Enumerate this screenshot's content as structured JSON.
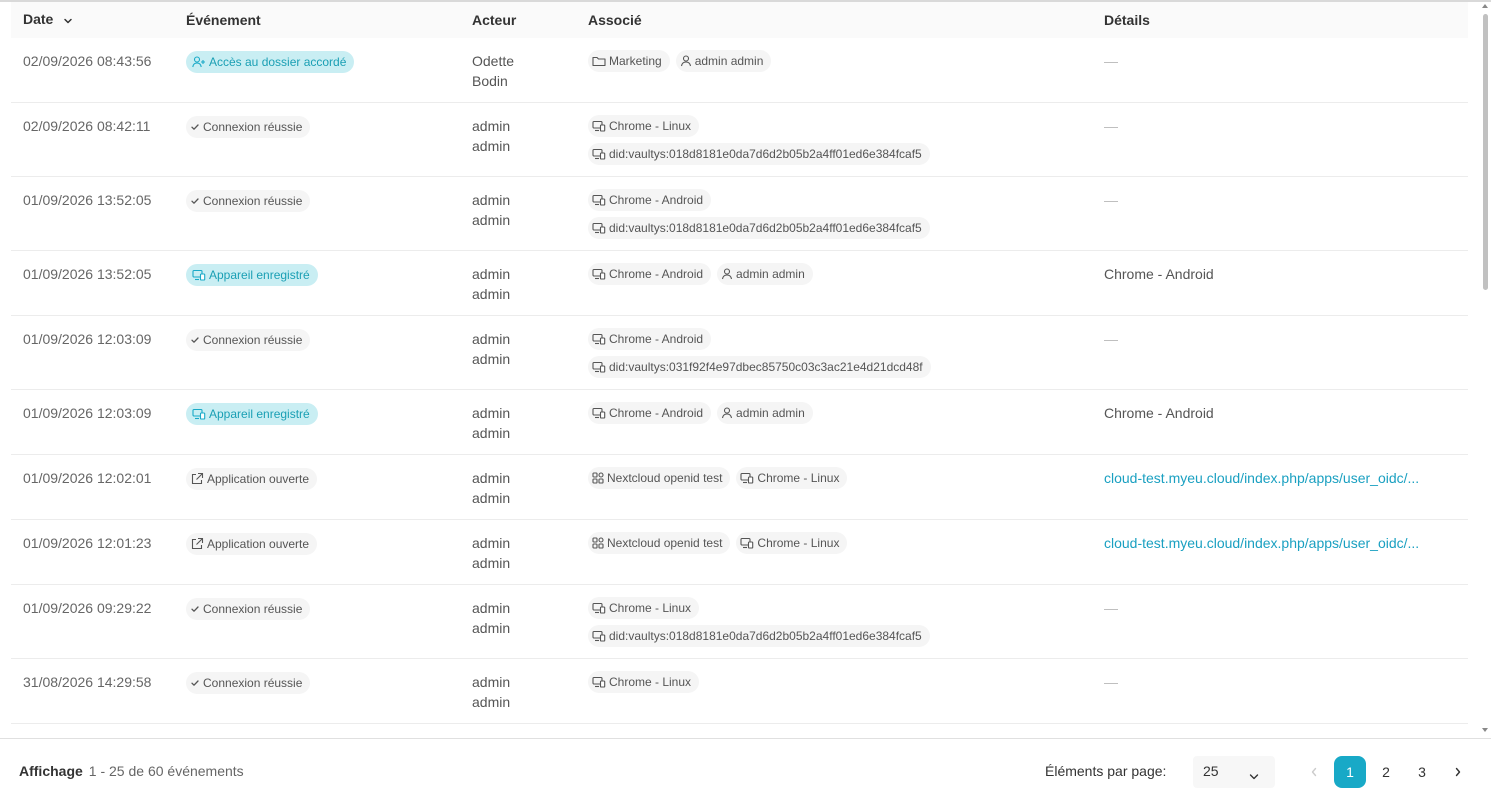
{
  "columns": {
    "date": "Date",
    "event": "Événement",
    "actor": "Acteur",
    "associated": "Associé",
    "details": "Détails"
  },
  "rows": [
    {
      "date": "02/09/2026 08:43:56",
      "event": "Accès au dossier accordé",
      "event_style": "accent",
      "event_icon": "user-plus-icon",
      "actor_line1": "Odette",
      "actor_line2": "Bodin",
      "assoc": [
        {
          "icon": "folder-icon",
          "label": "Marketing"
        },
        {
          "icon": "user-icon",
          "label": "admin admin"
        }
      ],
      "assoc_stack": false,
      "details": "—",
      "details_type": "dash"
    },
    {
      "date": "02/09/2026 08:42:11",
      "event": "Connexion réussie",
      "event_style": "plain",
      "event_icon": "check-icon",
      "actor_line1": "admin",
      "actor_line2": "admin",
      "assoc": [
        {
          "icon": "devices-icon",
          "label": "Chrome - Linux"
        },
        {
          "icon": "devices-icon",
          "label": "did:vaultys:018d8181e0da7d6d2b05b2a4ff01ed6e384fcaf5"
        }
      ],
      "assoc_stack": true,
      "details": "—",
      "details_type": "dash"
    },
    {
      "date": "01/09/2026 13:52:05",
      "event": "Connexion réussie",
      "event_style": "plain",
      "event_icon": "check-icon",
      "actor_line1": "admin",
      "actor_line2": "admin",
      "assoc": [
        {
          "icon": "devices-icon",
          "label": "Chrome - Android"
        },
        {
          "icon": "devices-icon",
          "label": "did:vaultys:018d8181e0da7d6d2b05b2a4ff01ed6e384fcaf5"
        }
      ],
      "assoc_stack": true,
      "details": "—",
      "details_type": "dash"
    },
    {
      "date": "01/09/2026 13:52:05",
      "event": "Appareil enregistré",
      "event_style": "accent",
      "event_icon": "devices-icon",
      "actor_line1": "admin",
      "actor_line2": "admin",
      "assoc": [
        {
          "icon": "devices-icon",
          "label": "Chrome - Android"
        },
        {
          "icon": "user-icon",
          "label": "admin admin"
        }
      ],
      "assoc_stack": false,
      "details": "Chrome - Android",
      "details_type": "text"
    },
    {
      "date": "01/09/2026 12:03:09",
      "event": "Connexion réussie",
      "event_style": "plain",
      "event_icon": "check-icon",
      "actor_line1": "admin",
      "actor_line2": "admin",
      "assoc": [
        {
          "icon": "devices-icon",
          "label": "Chrome - Android"
        },
        {
          "icon": "devices-icon",
          "label": "did:vaultys:031f92f4e97dbec85750c03c3ac21e4d21dcd48f"
        }
      ],
      "assoc_stack": true,
      "details": "—",
      "details_type": "dash"
    },
    {
      "date": "01/09/2026 12:03:09",
      "event": "Appareil enregistré",
      "event_style": "accent",
      "event_icon": "devices-icon",
      "actor_line1": "admin",
      "actor_line2": "admin",
      "assoc": [
        {
          "icon": "devices-icon",
          "label": "Chrome - Android"
        },
        {
          "icon": "user-icon",
          "label": "admin admin"
        }
      ],
      "assoc_stack": false,
      "details": "Chrome - Android",
      "details_type": "text"
    },
    {
      "date": "01/09/2026 12:02:01",
      "event": "Application ouverte",
      "event_style": "plain",
      "event_icon": "external-link-icon",
      "actor_line1": "admin",
      "actor_line2": "admin",
      "assoc": [
        {
          "icon": "apps-icon",
          "label": "Nextcloud openid test"
        },
        {
          "icon": "devices-icon",
          "label": "Chrome - Linux"
        }
      ],
      "assoc_stack": false,
      "details": "cloud-test.myeu.cloud/index.php/apps/user_oidc/...",
      "details_type": "link"
    },
    {
      "date": "01/09/2026 12:01:23",
      "event": "Application ouverte",
      "event_style": "plain",
      "event_icon": "external-link-icon",
      "actor_line1": "admin",
      "actor_line2": "admin",
      "assoc": [
        {
          "icon": "apps-icon",
          "label": "Nextcloud openid test"
        },
        {
          "icon": "devices-icon",
          "label": "Chrome - Linux"
        }
      ],
      "assoc_stack": false,
      "details": "cloud-test.myeu.cloud/index.php/apps/user_oidc/...",
      "details_type": "link"
    },
    {
      "date": "01/09/2026 09:29:22",
      "event": "Connexion réussie",
      "event_style": "plain",
      "event_icon": "check-icon",
      "actor_line1": "admin",
      "actor_line2": "admin",
      "assoc": [
        {
          "icon": "devices-icon",
          "label": "Chrome - Linux"
        },
        {
          "icon": "devices-icon",
          "label": "did:vaultys:018d8181e0da7d6d2b05b2a4ff01ed6e384fcaf5"
        }
      ],
      "assoc_stack": true,
      "details": "—",
      "details_type": "dash"
    },
    {
      "date": "31/08/2026 14:29:58",
      "event": "Connexion réussie",
      "event_style": "plain",
      "event_icon": "check-icon",
      "actor_line1": "admin",
      "actor_line2": "admin",
      "assoc": [
        {
          "icon": "devices-icon",
          "label": "Chrome - Linux"
        }
      ],
      "assoc_stack": true,
      "details": "—",
      "details_type": "dash"
    }
  ],
  "footer": {
    "showing_label": "Affichage",
    "showing_range": "1 - 25 de 60  événements",
    "per_page_label": "Éléments par page:",
    "per_page_value": "25",
    "pages": [
      "1",
      "2",
      "3"
    ],
    "current_page": "1"
  },
  "colors": {
    "accent": "#18a9c7",
    "accent_chip_bg": "#c9eef3",
    "link": "#1aa0c1"
  }
}
